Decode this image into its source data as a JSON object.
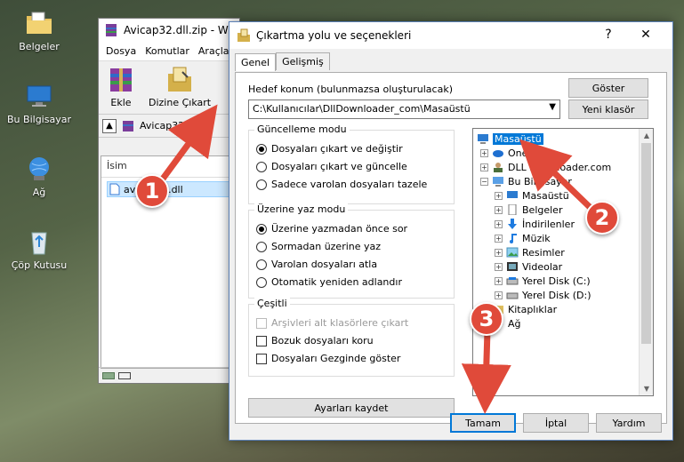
{
  "desktop": {
    "icons": [
      {
        "label": "Belgeler",
        "icon": "documents-folder-icon"
      },
      {
        "label": "Bu Bilgisayar",
        "icon": "computer-icon"
      },
      {
        "label": "Ağ",
        "icon": "network-icon"
      },
      {
        "label": "Çöp Kutusu",
        "icon": "recycle-bin-icon"
      }
    ]
  },
  "winrar": {
    "title": "Avicap32.dll.zip - W",
    "menu": [
      "Dosya",
      "Komutlar",
      "Araçla"
    ],
    "tools": [
      "Ekle",
      "Dizine Çıkart"
    ],
    "path": "Avicap32.dll",
    "column_header": "İsim",
    "file_row": "avicap32.dll"
  },
  "dialog": {
    "title": "Çıkartma yolu ve seçenekleri",
    "help": "?",
    "close": "✕",
    "tabs": [
      "Genel",
      "Gelişmiş"
    ],
    "dest_label": "Hedef konum (bulunmazsa oluşturulacak)",
    "dest_value": "C:\\Kullanıcılar\\DllDownloader_com\\Masaüstü",
    "show_button": "Göster",
    "new_folder_button": "Yeni klasör",
    "update_group": {
      "title": "Güncelleme modu",
      "options": [
        "Dosyaları çıkart ve değiştir",
        "Dosyaları çıkart ve güncelle",
        "Sadece varolan dosyaları tazele"
      ],
      "selected": 0
    },
    "overwrite_group": {
      "title": "Üzerine yaz modu",
      "options": [
        "Üzerine yazmadan önce sor",
        "Sormadan üzerine yaz",
        "Varolan dosyaları atla",
        "Otomatik yeniden adlandır"
      ],
      "selected": 0
    },
    "misc_group": {
      "title": "Çeşitli",
      "options": [
        "Arşivleri alt klasörlere çıkart",
        "Bozuk dosyaları koru",
        "Dosyaları Gezginde göster"
      ]
    },
    "save_settings": "Ayarları kaydet",
    "tree": [
      {
        "label": "Masaüstü",
        "selected": true
      },
      {
        "label": "OneDrive"
      },
      {
        "label": "DLL Downloader.com"
      },
      {
        "label": "Bu Bilgisayar"
      },
      {
        "label": "Masaüstü"
      },
      {
        "label": "Belgeler"
      },
      {
        "label": "İndirilenler"
      },
      {
        "label": "Müzik"
      },
      {
        "label": "Resimler"
      },
      {
        "label": "Videolar"
      },
      {
        "label": "Yerel Disk (C:)"
      },
      {
        "label": "Yerel Disk (D:)"
      },
      {
        "label": "Kitaplıklar"
      },
      {
        "label": "Ağ"
      }
    ],
    "ok": "Tamam",
    "cancel": "İptal",
    "help_button": "Yardım"
  },
  "annotations": [
    "1",
    "2",
    "3"
  ],
  "colors": {
    "accent": "#0078d7",
    "badge": "#e04a3a",
    "selection": "#cce8ff"
  }
}
